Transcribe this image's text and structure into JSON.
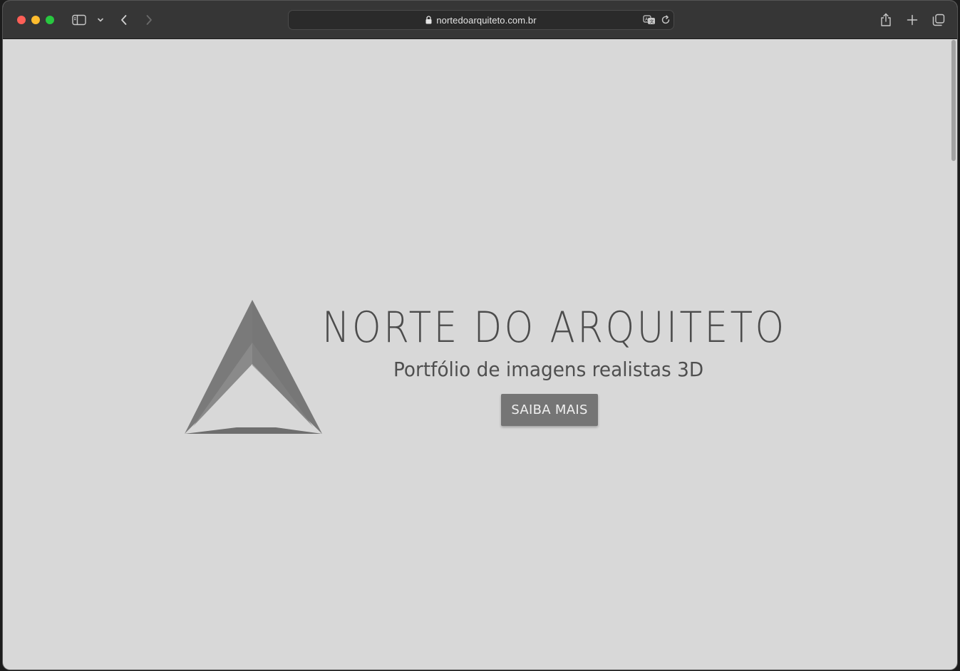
{
  "browser": {
    "url": "nortedoarquiteto.com.br",
    "icons": {
      "close": "close-dot",
      "minimize": "minimize-dot",
      "maximize": "maximize-dot",
      "sidebar": "sidebar-icon",
      "sidebar_menu": "chevron-down-icon",
      "back": "chevron-left-icon",
      "forward": "chevron-right-icon",
      "lock": "lock-icon",
      "translate": "translate-icon",
      "reload": "reload-icon",
      "share": "share-icon",
      "new_tab": "plus-icon",
      "tabs_overview": "tabs-icon"
    },
    "colors": {
      "close": "#fe5f57",
      "minimize": "#febc2e",
      "maximize": "#28c840",
      "toolbar": "#363636"
    }
  },
  "page": {
    "background": "#d8d8d8",
    "title": "NORTE DO ARQUITETO",
    "subtitle": "Portfólio de imagens realistas 3D",
    "cta_label": "SAIBA MAIS",
    "cta_color": "#757575"
  }
}
